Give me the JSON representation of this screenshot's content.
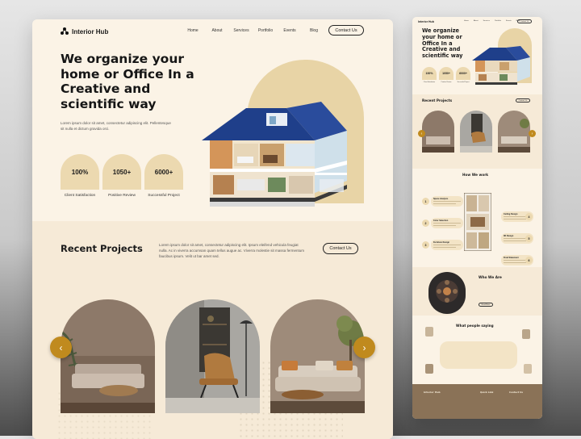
{
  "main": {
    "nav": {
      "logo": "Interior Hub",
      "links": [
        "Home",
        "About",
        "Services",
        "Portfolio",
        "Events",
        "Blog"
      ],
      "contact_label": "Contact Us"
    },
    "hero": {
      "title": "We organize your home or Office In a Creative and scientific way",
      "description": "Lorem ipsum dolor sit amet, consectetur adipiscing elit. Pellentesque sit nulla et dictum gravida orci.",
      "stats": [
        {
          "value": "100%",
          "label": "Client Satisfaction"
        },
        {
          "value": "1050+",
          "label": "Positive Review"
        },
        {
          "value": "6000+",
          "label": "Successful Project"
        }
      ]
    },
    "recent": {
      "title": "Recent Projects",
      "description": "Lorem ipsum dolor sit amet, consectetur adipiscing elit. Ipsum eleifend vehicula feugiat nulla. Ac in viverra accumsan quam tellus augue ac. Viverra molestie sit massa fermentum faucibus ipsum. Velit ut bar amet sed.",
      "contact_label": "Contact Us",
      "prev_arrow": "‹",
      "next_arrow": "›"
    }
  },
  "preview": {
    "nav": {
      "logo": "Interior Hub",
      "links": [
        "Home",
        "About",
        "Services",
        "Portfolio",
        "Events",
        "Blog"
      ],
      "contact_label": "Contact Us"
    },
    "hero": {
      "title": "We organize your home or Office In a Creative and scientific way",
      "stats": [
        {
          "value": "100%",
          "label": "Client Satisfaction"
        },
        {
          "value": "1050+",
          "label": "Positive Review"
        },
        {
          "value": "6000+",
          "label": "Successful Project"
        }
      ]
    },
    "recent_title": "Recent Projects",
    "recent_contact": "Contact Us",
    "how_title": "How We work",
    "steps": [
      {
        "num": "1",
        "title": "Space Analysis"
      },
      {
        "num": "2",
        "title": "Color Selection"
      },
      {
        "num": "3",
        "title": "Furniture Design"
      },
      {
        "num": "4",
        "title": "Ceiling Design"
      },
      {
        "num": "5",
        "title": "3D Design"
      },
      {
        "num": "6",
        "title": "Final Statement"
      }
    ],
    "who_title": "Who We Are",
    "who_button": "Read More",
    "testimonial_title": "What people saying",
    "footer_logo": "Interior Hub",
    "footer_col1": "Quick Link",
    "footer_col2": "Contact Us"
  }
}
